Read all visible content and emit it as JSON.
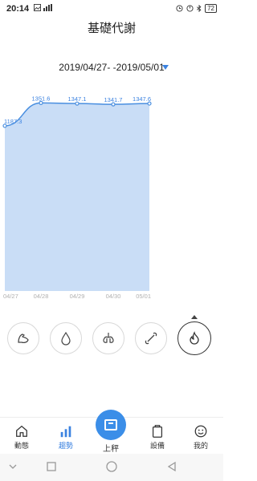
{
  "status_bar": {
    "time": "20:14",
    "battery": "72"
  },
  "header": {
    "title": "基礎代謝"
  },
  "date_range": {
    "label": "2019/04/27- -2019/05/01"
  },
  "chart_data": {
    "type": "area",
    "categories": [
      "04/27",
      "04/28",
      "04/29",
      "04/30",
      "05/01"
    ],
    "series": [
      {
        "values": [
          1187.3,
          1351.6,
          1347.1,
          1341.7,
          1347.6
        ]
      }
    ],
    "data_labels": [
      "1187.3",
      "1351.6",
      "1347.1",
      "1341.7",
      "1347.6"
    ],
    "ylim": [
      0,
      1400
    ],
    "colors": {
      "line": "#4a8fe0",
      "fill": "#c9ddf6",
      "label": "#3b82e0",
      "tick": "#b0b0b0"
    }
  },
  "metrics": [
    {
      "icon": "muscle-icon"
    },
    {
      "icon": "water-drop-icon"
    },
    {
      "icon": "lungs-icon"
    },
    {
      "icon": "bone-icon"
    },
    {
      "icon": "flame-icon",
      "active": true
    }
  ],
  "bottom_nav": {
    "items": [
      {
        "label": "動態",
        "icon": "home-icon"
      },
      {
        "label": "趨勢",
        "icon": "trend-bars-icon",
        "active": true
      },
      {
        "label": "設備",
        "icon": "device-icon"
      },
      {
        "label": "我的",
        "icon": "smiley-icon"
      }
    ],
    "scale_label": "上秤"
  },
  "accent_color": "#3b82e0"
}
